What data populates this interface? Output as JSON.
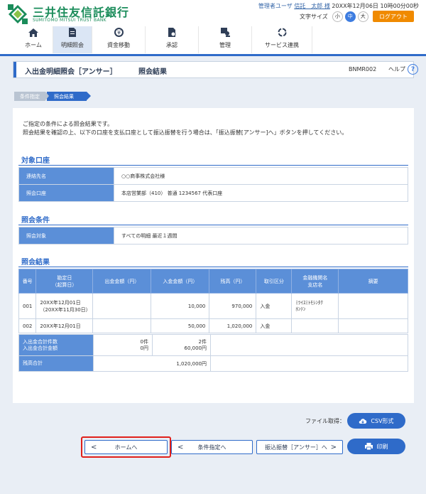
{
  "header": {
    "bank_name": "三井住友信託銀行",
    "bank_name_en": "SUMITOMO MITSUI TRUST BANK",
    "user_role": "管理者ユーザ",
    "user_name": "信託　太郎 様",
    "datetime": "20XX年12月06日 10時00分00秒",
    "font_size_label": "文字サイズ",
    "font_sizes": [
      "小",
      "中",
      "大"
    ],
    "logout": "ログアウト"
  },
  "nav": {
    "items": [
      {
        "label": "ホーム",
        "icon": "home-icon"
      },
      {
        "label": "明細照会",
        "icon": "document-icon",
        "active": true
      },
      {
        "label": "資金移動",
        "icon": "money-transfer-icon"
      },
      {
        "label": "承認",
        "icon": "approval-icon"
      },
      {
        "label": "管理",
        "icon": "admin-icon"
      },
      {
        "label": "サービス連携",
        "icon": "service-link-icon"
      }
    ]
  },
  "title": {
    "main": "入出金明細照会［アンサー］",
    "sub": "照会結果",
    "code": "BNMR002",
    "help": "ヘルプ"
  },
  "steps": [
    "条件指定",
    "照会結果"
  ],
  "description": [
    "ご指定の条件による照会結果です。",
    "照会結果を確認の上、以下の口座を支払口座として振込振替を行う場合は、「振込振替[アンサー]へ」ボタンを押してください。"
  ],
  "account": {
    "title": "対象口座",
    "rows": [
      {
        "key": "連絡先名",
        "value": "○○商事株式会社様"
      },
      {
        "key": "照会口座",
        "value": "本店営業部（410） 普通 1234567 代表口座"
      }
    ]
  },
  "conditions": {
    "title": "照会条件",
    "rows": [
      {
        "key": "照会対象",
        "value": "すべての明細 最近１週間"
      }
    ]
  },
  "results": {
    "title": "照会結果",
    "headers": [
      "番号",
      "勘定日\n（起算日）",
      "出金金額（円）",
      "入金金額（円）",
      "残高（円）",
      "取引区分",
      "金融機関名\n支店名",
      "摘要"
    ],
    "rows": [
      {
        "no": "001",
        "date": "20XX年12月01日",
        "date2": "（20XX年11月30日）",
        "withdrawal": "",
        "deposit": "10,000",
        "balance": "970,000",
        "type": "入金",
        "bank": "ﾐﾂｲｽﾐﾄﾓｼﾝﾀｸ",
        "branch": "ﾎﾝﾃﾝ",
        "memo": ""
      },
      {
        "no": "002",
        "date": "20XX年12月01日",
        "date2": "",
        "withdrawal": "",
        "deposit": "50,000",
        "balance": "1,020,000",
        "type": "入金",
        "bank": "",
        "branch": "",
        "memo": ""
      }
    ],
    "totals": {
      "count_label1": "入出金合計件数",
      "count_label2": "入出金合計金額",
      "withdraw_count": "0件",
      "withdraw_amount": "0円",
      "deposit_count": "2件",
      "deposit_amount": "60,000円",
      "balance_label": "残高合計",
      "balance_total": "1,020,000円"
    }
  },
  "footer": {
    "file_label": "ファイル取得：",
    "csv_button": "CSV形式",
    "home_button": "ホームへ",
    "conditions_button": "条件指定へ",
    "transfer_button": "振込振替［アンサー］へ",
    "print_button": "印刷"
  }
}
